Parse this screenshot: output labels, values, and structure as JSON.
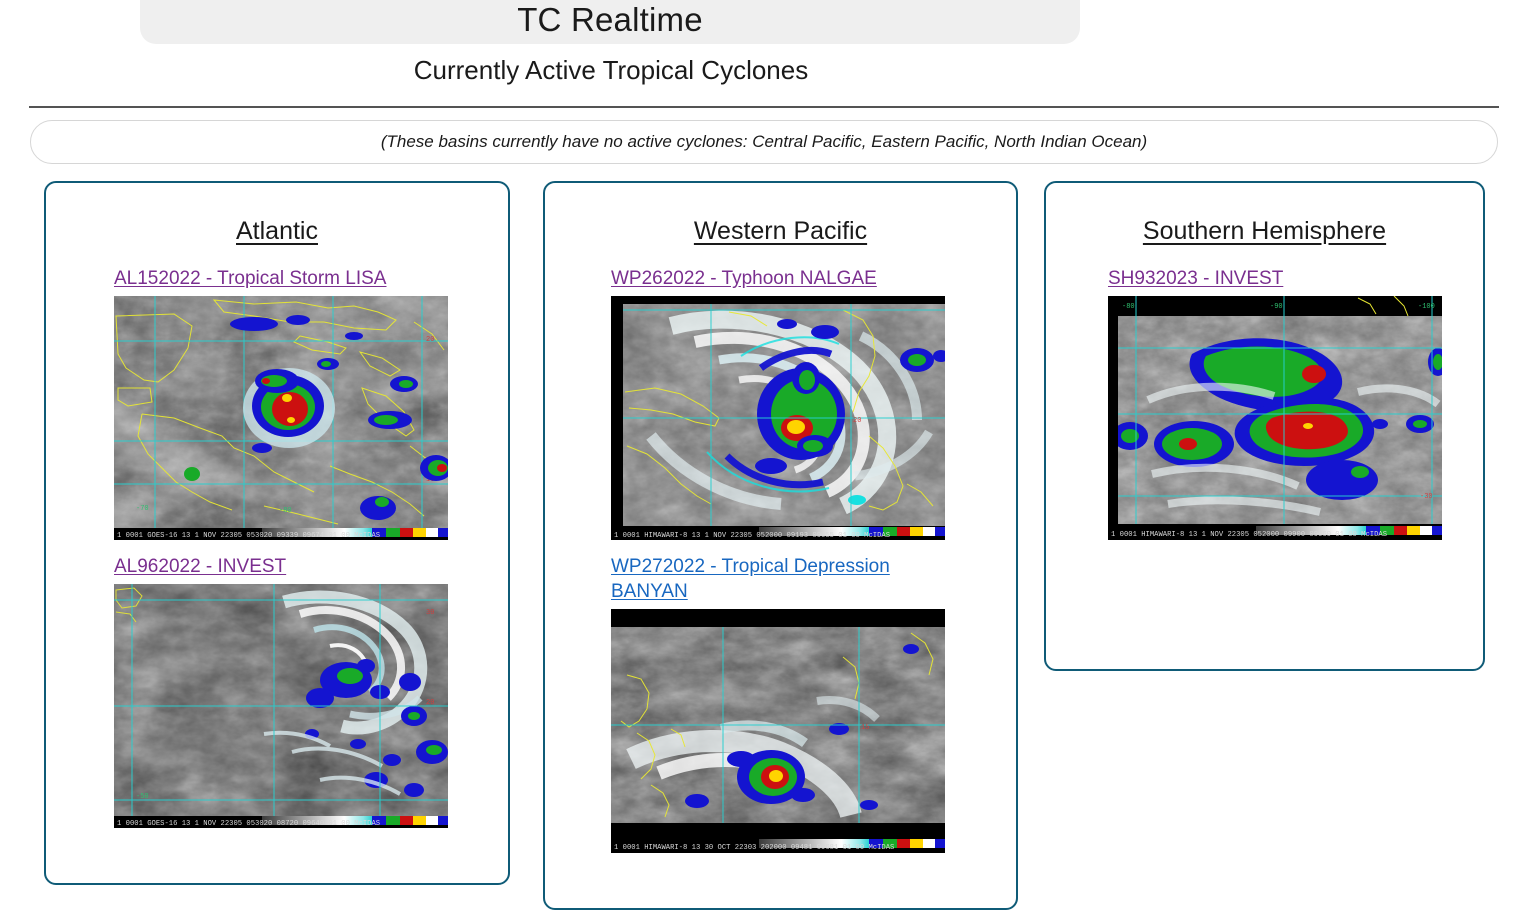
{
  "header": {
    "app_title": "TC Realtime",
    "subtitle": "Currently Active Tropical Cyclones",
    "notice": "(These basins currently have no active cyclones: Central Pacific, Eastern Pacific, North Indian Ocean)"
  },
  "theme": {
    "card_border": "#0f5b77",
    "pill_background": "#efefef",
    "visited_link": "#7a2f8f",
    "unvisited_link": "#1867c0",
    "divider": "#545454"
  },
  "basins": [
    {
      "name": "Atlantic",
      "storms": [
        {
          "label": "AL152022 - Tropical Storm LISA",
          "link_state": "visited",
          "image": {
            "satellite": "GOES-16",
            "caption": "1 0001  GOES-16      13   1 NOV 22305 053020 09339 09674 01 00        McIDAS",
            "alt": "infrared satellite imagery of Tropical Storm Lisa over the western Caribbean"
          }
        },
        {
          "label": "AL962022 - INVEST",
          "link_state": "visited",
          "image": {
            "satellite": "GOES-16",
            "caption": "1 0001  GOES-16      13   1 NOV 22305 053020 08720 09640 01 00        McIDAS",
            "alt": "infrared satellite imagery of Invest AL96 in the central Atlantic"
          }
        }
      ]
    },
    {
      "name": "Western Pacific",
      "storms": [
        {
          "label": "WP262022 - Typhoon NALGAE",
          "link_state": "visited",
          "image": {
            "satellite": "HIMAWARI-8",
            "caption": "1 0001  HIMAWARI-8 13   1 NOV 22305 052000 09193 09655 01 00        McIDAS",
            "alt": "infrared satellite imagery of Typhoon Nalgae near the South China Sea"
          }
        },
        {
          "label": "WP272022 - Tropical Depression BANYAN",
          "link_state": "unvisited",
          "image": {
            "satellite": "HIMAWARI-8",
            "caption": "1 0001  HIMAWARI-8 13  30 OCT 22303 202000 09481 09681 01 00        McIDAS",
            "alt": "infrared satellite imagery of Tropical Depression Banyan east of the Philippines"
          }
        }
      ]
    },
    {
      "name": "Southern Hemisphere",
      "storms": [
        {
          "label": "SH932023 - INVEST",
          "link_state": "visited",
          "image": {
            "satellite": "HIMAWARI-8",
            "caption": "1 0001  HIMAWARI-8 13   1 NOV 22305 052000 09900 09660 01 00        McIDAS",
            "alt": "infrared satellite imagery of Invest SH93 in the Southern Hemisphere"
          }
        }
      ]
    }
  ]
}
